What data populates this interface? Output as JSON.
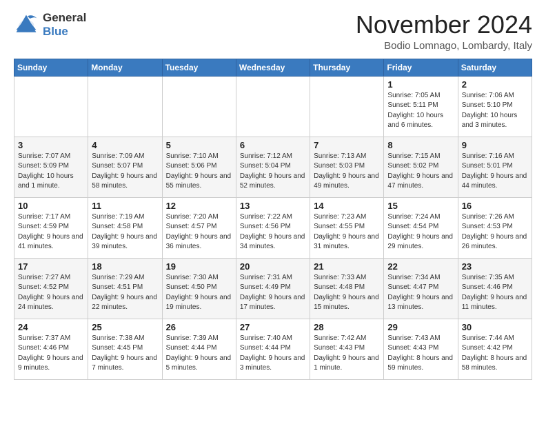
{
  "logo": {
    "general": "General",
    "blue": "Blue"
  },
  "header": {
    "month": "November 2024",
    "location": "Bodio Lomnago, Lombardy, Italy"
  },
  "weekdays": [
    "Sunday",
    "Monday",
    "Tuesday",
    "Wednesday",
    "Thursday",
    "Friday",
    "Saturday"
  ],
  "weeks": [
    [
      {
        "day": "",
        "info": ""
      },
      {
        "day": "",
        "info": ""
      },
      {
        "day": "",
        "info": ""
      },
      {
        "day": "",
        "info": ""
      },
      {
        "day": "",
        "info": ""
      },
      {
        "day": "1",
        "info": "Sunrise: 7:05 AM\nSunset: 5:11 PM\nDaylight: 10 hours and 6 minutes."
      },
      {
        "day": "2",
        "info": "Sunrise: 7:06 AM\nSunset: 5:10 PM\nDaylight: 10 hours and 3 minutes."
      }
    ],
    [
      {
        "day": "3",
        "info": "Sunrise: 7:07 AM\nSunset: 5:09 PM\nDaylight: 10 hours and 1 minute."
      },
      {
        "day": "4",
        "info": "Sunrise: 7:09 AM\nSunset: 5:07 PM\nDaylight: 9 hours and 58 minutes."
      },
      {
        "day": "5",
        "info": "Sunrise: 7:10 AM\nSunset: 5:06 PM\nDaylight: 9 hours and 55 minutes."
      },
      {
        "day": "6",
        "info": "Sunrise: 7:12 AM\nSunset: 5:04 PM\nDaylight: 9 hours and 52 minutes."
      },
      {
        "day": "7",
        "info": "Sunrise: 7:13 AM\nSunset: 5:03 PM\nDaylight: 9 hours and 49 minutes."
      },
      {
        "day": "8",
        "info": "Sunrise: 7:15 AM\nSunset: 5:02 PM\nDaylight: 9 hours and 47 minutes."
      },
      {
        "day": "9",
        "info": "Sunrise: 7:16 AM\nSunset: 5:01 PM\nDaylight: 9 hours and 44 minutes."
      }
    ],
    [
      {
        "day": "10",
        "info": "Sunrise: 7:17 AM\nSunset: 4:59 PM\nDaylight: 9 hours and 41 minutes."
      },
      {
        "day": "11",
        "info": "Sunrise: 7:19 AM\nSunset: 4:58 PM\nDaylight: 9 hours and 39 minutes."
      },
      {
        "day": "12",
        "info": "Sunrise: 7:20 AM\nSunset: 4:57 PM\nDaylight: 9 hours and 36 minutes."
      },
      {
        "day": "13",
        "info": "Sunrise: 7:22 AM\nSunset: 4:56 PM\nDaylight: 9 hours and 34 minutes."
      },
      {
        "day": "14",
        "info": "Sunrise: 7:23 AM\nSunset: 4:55 PM\nDaylight: 9 hours and 31 minutes."
      },
      {
        "day": "15",
        "info": "Sunrise: 7:24 AM\nSunset: 4:54 PM\nDaylight: 9 hours and 29 minutes."
      },
      {
        "day": "16",
        "info": "Sunrise: 7:26 AM\nSunset: 4:53 PM\nDaylight: 9 hours and 26 minutes."
      }
    ],
    [
      {
        "day": "17",
        "info": "Sunrise: 7:27 AM\nSunset: 4:52 PM\nDaylight: 9 hours and 24 minutes."
      },
      {
        "day": "18",
        "info": "Sunrise: 7:29 AM\nSunset: 4:51 PM\nDaylight: 9 hours and 22 minutes."
      },
      {
        "day": "19",
        "info": "Sunrise: 7:30 AM\nSunset: 4:50 PM\nDaylight: 9 hours and 19 minutes."
      },
      {
        "day": "20",
        "info": "Sunrise: 7:31 AM\nSunset: 4:49 PM\nDaylight: 9 hours and 17 minutes."
      },
      {
        "day": "21",
        "info": "Sunrise: 7:33 AM\nSunset: 4:48 PM\nDaylight: 9 hours and 15 minutes."
      },
      {
        "day": "22",
        "info": "Sunrise: 7:34 AM\nSunset: 4:47 PM\nDaylight: 9 hours and 13 minutes."
      },
      {
        "day": "23",
        "info": "Sunrise: 7:35 AM\nSunset: 4:46 PM\nDaylight: 9 hours and 11 minutes."
      }
    ],
    [
      {
        "day": "24",
        "info": "Sunrise: 7:37 AM\nSunset: 4:46 PM\nDaylight: 9 hours and 9 minutes."
      },
      {
        "day": "25",
        "info": "Sunrise: 7:38 AM\nSunset: 4:45 PM\nDaylight: 9 hours and 7 minutes."
      },
      {
        "day": "26",
        "info": "Sunrise: 7:39 AM\nSunset: 4:44 PM\nDaylight: 9 hours and 5 minutes."
      },
      {
        "day": "27",
        "info": "Sunrise: 7:40 AM\nSunset: 4:44 PM\nDaylight: 9 hours and 3 minutes."
      },
      {
        "day": "28",
        "info": "Sunrise: 7:42 AM\nSunset: 4:43 PM\nDaylight: 9 hours and 1 minute."
      },
      {
        "day": "29",
        "info": "Sunrise: 7:43 AM\nSunset: 4:43 PM\nDaylight: 8 hours and 59 minutes."
      },
      {
        "day": "30",
        "info": "Sunrise: 7:44 AM\nSunset: 4:42 PM\nDaylight: 8 hours and 58 minutes."
      }
    ]
  ]
}
